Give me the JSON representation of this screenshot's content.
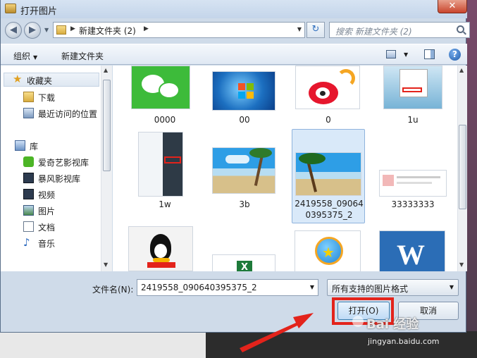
{
  "window": {
    "title": "打开图片",
    "close_label": "✕"
  },
  "nav": {
    "back_glyph": "◀",
    "forward_glyph": "▶",
    "address_crumb": "新建文件夹 (2)",
    "refresh_glyph": "↻",
    "search_placeholder": "搜索 新建文件夹 (2)"
  },
  "toolbar": {
    "organize": "组织",
    "new_folder": "新建文件夹",
    "help": "?"
  },
  "sidebar": {
    "items": [
      {
        "label": "收藏夹",
        "icon": "star-icon"
      },
      {
        "label": "下载",
        "icon": "folder-icon"
      },
      {
        "label": "最近访问的位置",
        "icon": "recent-places-icon"
      },
      {
        "label": "库",
        "icon": "library-icon"
      },
      {
        "label": "爱奇艺影视库",
        "icon": "iqiyi-icon"
      },
      {
        "label": "暴风影视库",
        "icon": "video-library-icon"
      },
      {
        "label": "视频",
        "icon": "video-icon"
      },
      {
        "label": "图片",
        "icon": "pictures-icon"
      },
      {
        "label": "文档",
        "icon": "documents-icon"
      },
      {
        "label": "音乐",
        "icon": "music-icon"
      }
    ]
  },
  "files": [
    {
      "name": "0000",
      "thumb": "wechat-logo"
    },
    {
      "name": "00",
      "thumb": "windows7-wallpaper"
    },
    {
      "name": "0",
      "thumb": "weibo-logo"
    },
    {
      "name": "1u",
      "thumb": "menu-screenshot"
    },
    {
      "name": "1w",
      "thumb": "phone-screenshot"
    },
    {
      "name": "3b",
      "thumb": "beach-photo"
    },
    {
      "name": "2419558_090640395375_2",
      "name_line1": "2419558_09064",
      "name_line2": "0395375_2",
      "thumb": "palm-beach-photo",
      "selected": true
    },
    {
      "name": "33333333",
      "thumb": "webpage-screenshot"
    },
    {
      "name": "",
      "thumb": "qq-penguin"
    },
    {
      "name": "",
      "thumb": "excel-icon"
    },
    {
      "name": "",
      "thumb": "zhuan-logo"
    },
    {
      "name": "",
      "thumb": "word-icon"
    }
  ],
  "footer": {
    "filename_label": "文件名(N):",
    "filename_value": "2419558_090640395375_2",
    "filter_value": "所有支持的图片格式",
    "open_label": "打开(O)",
    "cancel_label": "取消"
  },
  "watermark": {
    "brand": "Bai 经验",
    "url": "jingyan.baidu.com"
  },
  "colors": {
    "highlight": "#e3231b",
    "selection": "#d9e9f9"
  }
}
